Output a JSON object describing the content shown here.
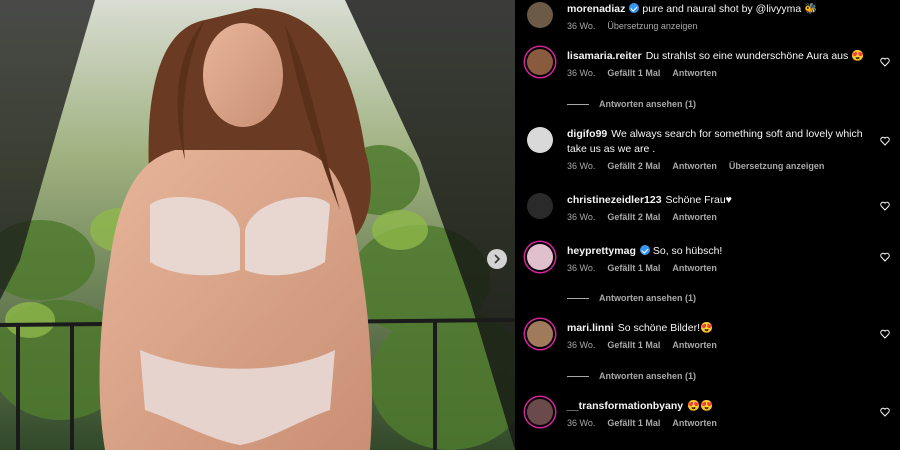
{
  "post": {
    "author": "morenadiaz",
    "caption": "pure and naural shot by @livyyma 🐝",
    "time": "36 Wo.",
    "translate": "Übersetzung anzeigen"
  },
  "comments": [
    {
      "user": "lisamaria.reiter",
      "text": "Du strahlst so eine wunderschöne Aura aus 😍",
      "time": "36 Wo.",
      "likes": "Gefällt 1 Mal",
      "reply": "Antworten",
      "view_replies": "Antworten ansehen (1)"
    },
    {
      "user": "digifo99",
      "text": "We always search for something soft and lovely which take us as we are .",
      "time": "36 Wo.",
      "likes": "Gefällt 2 Mal",
      "reply": "Antworten",
      "translate": "Übersetzung anzeigen"
    },
    {
      "user": "christinezeidler123",
      "text": "Schöne Frau♥",
      "time": "36 Wo.",
      "likes": "Gefällt 2 Mal",
      "reply": "Antworten"
    },
    {
      "user": "heyprettymag",
      "text": "So, so hübsch!",
      "time": "36 Wo.",
      "likes": "Gefällt 1 Mal",
      "reply": "Antworten",
      "view_replies": "Antworten ansehen (1)"
    },
    {
      "user": "mari.linni",
      "text": "So schöne Bilder!😍",
      "time": "36 Wo.",
      "likes": "Gefällt 1 Mal",
      "reply": "Antworten",
      "view_replies": "Antworten ansehen (1)"
    },
    {
      "user": "__transformationbyany",
      "text": "😍😍",
      "time": "36 Wo.",
      "likes": "Gefällt 1 Mal",
      "reply": "Antworten"
    }
  ],
  "colors": {
    "accent": "#3797f0",
    "ring": "#d6249f",
    "muted": "#a8a8a8"
  },
  "icons": {
    "next": "chevron-right-icon",
    "like": "heart-outline-icon",
    "verified": "verified-badge-icon"
  }
}
